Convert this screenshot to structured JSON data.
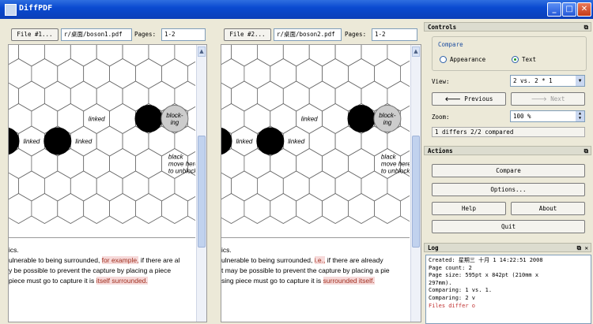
{
  "window": {
    "title": "DiffPDF",
    "minimize": "_",
    "maximize": "□",
    "close": "✕"
  },
  "left": {
    "file_button": "File #1...",
    "file_path": "r/桌面/boson1.pdf",
    "pages_label": "Pages:",
    "pages_value": "1-2",
    "board_labels": [
      "linked",
      "linked",
      "linked",
      "block-\ning",
      "black\nmove here\nto unblock",
      "lin"
    ],
    "text_lines": [
      {
        "parts": [
          {
            "t": "ics.",
            "h": false
          }
        ]
      },
      {
        "parts": [
          {
            "t": "ulnerable to being surrounded, ",
            "h": false
          },
          {
            "t": "for example,",
            "h": true
          },
          {
            "t": " if there are al",
            "h": false
          }
        ]
      },
      {
        "parts": [
          {
            "t": "y be possible to prevent the capture by placing a piece",
            "h": false
          }
        ]
      },
      {
        "parts": [
          {
            "t": " piece must go to capture it is ",
            "h": false
          },
          {
            "t": "itself surrounded.",
            "h": true
          }
        ]
      }
    ]
  },
  "right": {
    "file_button": "File #2...",
    "file_path": "r/桌面/boson2.pdf",
    "pages_label": "Pages:",
    "pages_value": "1-2",
    "board_labels": [
      "linked",
      "linked",
      "linked",
      "block-\ning",
      "black\nmove here\nto unblock",
      "lin"
    ],
    "text_lines": [
      {
        "parts": [
          {
            "t": "ics.",
            "h": false
          }
        ]
      },
      {
        "parts": [
          {
            "t": "ulnerable to being surrounded, ",
            "h": false
          },
          {
            "t": "i.e.,",
            "h": true
          },
          {
            "t": " if there are already",
            "h": false
          }
        ]
      },
      {
        "parts": [
          {
            "t": "t may be possible to prevent the capture by placing a pie",
            "h": false
          }
        ]
      },
      {
        "parts": [
          {
            "t": "sing piece must go to capture it is ",
            "h": false
          },
          {
            "t": "surrounded itself.",
            "h": true
          }
        ]
      }
    ]
  },
  "controls": {
    "header": "Controls",
    "compare_group": "Compare",
    "appearance": "Appearance",
    "text": "Text",
    "selected_mode": "Text",
    "view_label": "View:",
    "view_value": "2 vs. 2 * 1",
    "previous": "Previous",
    "next": "Next",
    "zoom_label": "Zoom:",
    "zoom_value": "100 %",
    "status": "1 differs 2/2 compared"
  },
  "actions": {
    "header": "Actions",
    "compare": "Compare",
    "options": "Options...",
    "help": "Help",
    "about": "About",
    "quit": "Quit"
  },
  "log": {
    "header": "Log",
    "lines": [
      {
        "text": "Created: 星期三 十月 1 14:22:51 2008",
        "color": "#000000"
      },
      {
        "text": "Page count: 2",
        "color": "#000000"
      },
      {
        "text": "Page size: 595pt x 842pt (210mm x",
        "color": "#000000"
      },
      {
        "text": "297mm).",
        "color": "#000000"
      },
      {
        "text": "Comparing: 1 vs. 1.",
        "color": "#000000"
      },
      {
        "text": "Comparing: 2 v",
        "color": "#000000"
      },
      {
        "text": "Files differ o",
        "color": "#c03030"
      }
    ]
  },
  "colors": {
    "titlebar": "#0a4ad0",
    "highlight": "#f6d9d9",
    "highlight_text": "#a03020",
    "log_error": "#c03030"
  }
}
